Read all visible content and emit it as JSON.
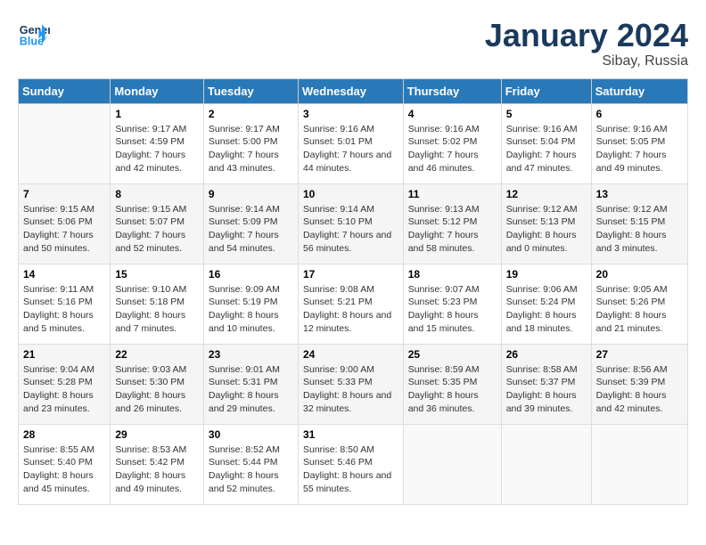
{
  "header": {
    "logo_line1": "General",
    "logo_line2": "Blue",
    "month_title": "January 2024",
    "location": "Sibay, Russia"
  },
  "days_of_week": [
    "Sunday",
    "Monday",
    "Tuesday",
    "Wednesday",
    "Thursday",
    "Friday",
    "Saturday"
  ],
  "weeks": [
    [
      {
        "day": "",
        "sunrise": "",
        "sunset": "",
        "daylight": ""
      },
      {
        "day": "1",
        "sunrise": "Sunrise: 9:17 AM",
        "sunset": "Sunset: 4:59 PM",
        "daylight": "Daylight: 7 hours and 42 minutes."
      },
      {
        "day": "2",
        "sunrise": "Sunrise: 9:17 AM",
        "sunset": "Sunset: 5:00 PM",
        "daylight": "Daylight: 7 hours and 43 minutes."
      },
      {
        "day": "3",
        "sunrise": "Sunrise: 9:16 AM",
        "sunset": "Sunset: 5:01 PM",
        "daylight": "Daylight: 7 hours and 44 minutes."
      },
      {
        "day": "4",
        "sunrise": "Sunrise: 9:16 AM",
        "sunset": "Sunset: 5:02 PM",
        "daylight": "Daylight: 7 hours and 46 minutes."
      },
      {
        "day": "5",
        "sunrise": "Sunrise: 9:16 AM",
        "sunset": "Sunset: 5:04 PM",
        "daylight": "Daylight: 7 hours and 47 minutes."
      },
      {
        "day": "6",
        "sunrise": "Sunrise: 9:16 AM",
        "sunset": "Sunset: 5:05 PM",
        "daylight": "Daylight: 7 hours and 49 minutes."
      }
    ],
    [
      {
        "day": "7",
        "sunrise": "Sunrise: 9:15 AM",
        "sunset": "Sunset: 5:06 PM",
        "daylight": "Daylight: 7 hours and 50 minutes."
      },
      {
        "day": "8",
        "sunrise": "Sunrise: 9:15 AM",
        "sunset": "Sunset: 5:07 PM",
        "daylight": "Daylight: 7 hours and 52 minutes."
      },
      {
        "day": "9",
        "sunrise": "Sunrise: 9:14 AM",
        "sunset": "Sunset: 5:09 PM",
        "daylight": "Daylight: 7 hours and 54 minutes."
      },
      {
        "day": "10",
        "sunrise": "Sunrise: 9:14 AM",
        "sunset": "Sunset: 5:10 PM",
        "daylight": "Daylight: 7 hours and 56 minutes."
      },
      {
        "day": "11",
        "sunrise": "Sunrise: 9:13 AM",
        "sunset": "Sunset: 5:12 PM",
        "daylight": "Daylight: 7 hours and 58 minutes."
      },
      {
        "day": "12",
        "sunrise": "Sunrise: 9:12 AM",
        "sunset": "Sunset: 5:13 PM",
        "daylight": "Daylight: 8 hours and 0 minutes."
      },
      {
        "day": "13",
        "sunrise": "Sunrise: 9:12 AM",
        "sunset": "Sunset: 5:15 PM",
        "daylight": "Daylight: 8 hours and 3 minutes."
      }
    ],
    [
      {
        "day": "14",
        "sunrise": "Sunrise: 9:11 AM",
        "sunset": "Sunset: 5:16 PM",
        "daylight": "Daylight: 8 hours and 5 minutes."
      },
      {
        "day": "15",
        "sunrise": "Sunrise: 9:10 AM",
        "sunset": "Sunset: 5:18 PM",
        "daylight": "Daylight: 8 hours and 7 minutes."
      },
      {
        "day": "16",
        "sunrise": "Sunrise: 9:09 AM",
        "sunset": "Sunset: 5:19 PM",
        "daylight": "Daylight: 8 hours and 10 minutes."
      },
      {
        "day": "17",
        "sunrise": "Sunrise: 9:08 AM",
        "sunset": "Sunset: 5:21 PM",
        "daylight": "Daylight: 8 hours and 12 minutes."
      },
      {
        "day": "18",
        "sunrise": "Sunrise: 9:07 AM",
        "sunset": "Sunset: 5:23 PM",
        "daylight": "Daylight: 8 hours and 15 minutes."
      },
      {
        "day": "19",
        "sunrise": "Sunrise: 9:06 AM",
        "sunset": "Sunset: 5:24 PM",
        "daylight": "Daylight: 8 hours and 18 minutes."
      },
      {
        "day": "20",
        "sunrise": "Sunrise: 9:05 AM",
        "sunset": "Sunset: 5:26 PM",
        "daylight": "Daylight: 8 hours and 21 minutes."
      }
    ],
    [
      {
        "day": "21",
        "sunrise": "Sunrise: 9:04 AM",
        "sunset": "Sunset: 5:28 PM",
        "daylight": "Daylight: 8 hours and 23 minutes."
      },
      {
        "day": "22",
        "sunrise": "Sunrise: 9:03 AM",
        "sunset": "Sunset: 5:30 PM",
        "daylight": "Daylight: 8 hours and 26 minutes."
      },
      {
        "day": "23",
        "sunrise": "Sunrise: 9:01 AM",
        "sunset": "Sunset: 5:31 PM",
        "daylight": "Daylight: 8 hours and 29 minutes."
      },
      {
        "day": "24",
        "sunrise": "Sunrise: 9:00 AM",
        "sunset": "Sunset: 5:33 PM",
        "daylight": "Daylight: 8 hours and 32 minutes."
      },
      {
        "day": "25",
        "sunrise": "Sunrise: 8:59 AM",
        "sunset": "Sunset: 5:35 PM",
        "daylight": "Daylight: 8 hours and 36 minutes."
      },
      {
        "day": "26",
        "sunrise": "Sunrise: 8:58 AM",
        "sunset": "Sunset: 5:37 PM",
        "daylight": "Daylight: 8 hours and 39 minutes."
      },
      {
        "day": "27",
        "sunrise": "Sunrise: 8:56 AM",
        "sunset": "Sunset: 5:39 PM",
        "daylight": "Daylight: 8 hours and 42 minutes."
      }
    ],
    [
      {
        "day": "28",
        "sunrise": "Sunrise: 8:55 AM",
        "sunset": "Sunset: 5:40 PM",
        "daylight": "Daylight: 8 hours and 45 minutes."
      },
      {
        "day": "29",
        "sunrise": "Sunrise: 8:53 AM",
        "sunset": "Sunset: 5:42 PM",
        "daylight": "Daylight: 8 hours and 49 minutes."
      },
      {
        "day": "30",
        "sunrise": "Sunrise: 8:52 AM",
        "sunset": "Sunset: 5:44 PM",
        "daylight": "Daylight: 8 hours and 52 minutes."
      },
      {
        "day": "31",
        "sunrise": "Sunrise: 8:50 AM",
        "sunset": "Sunset: 5:46 PM",
        "daylight": "Daylight: 8 hours and 55 minutes."
      },
      {
        "day": "",
        "sunrise": "",
        "sunset": "",
        "daylight": ""
      },
      {
        "day": "",
        "sunrise": "",
        "sunset": "",
        "daylight": ""
      },
      {
        "day": "",
        "sunrise": "",
        "sunset": "",
        "daylight": ""
      }
    ]
  ]
}
